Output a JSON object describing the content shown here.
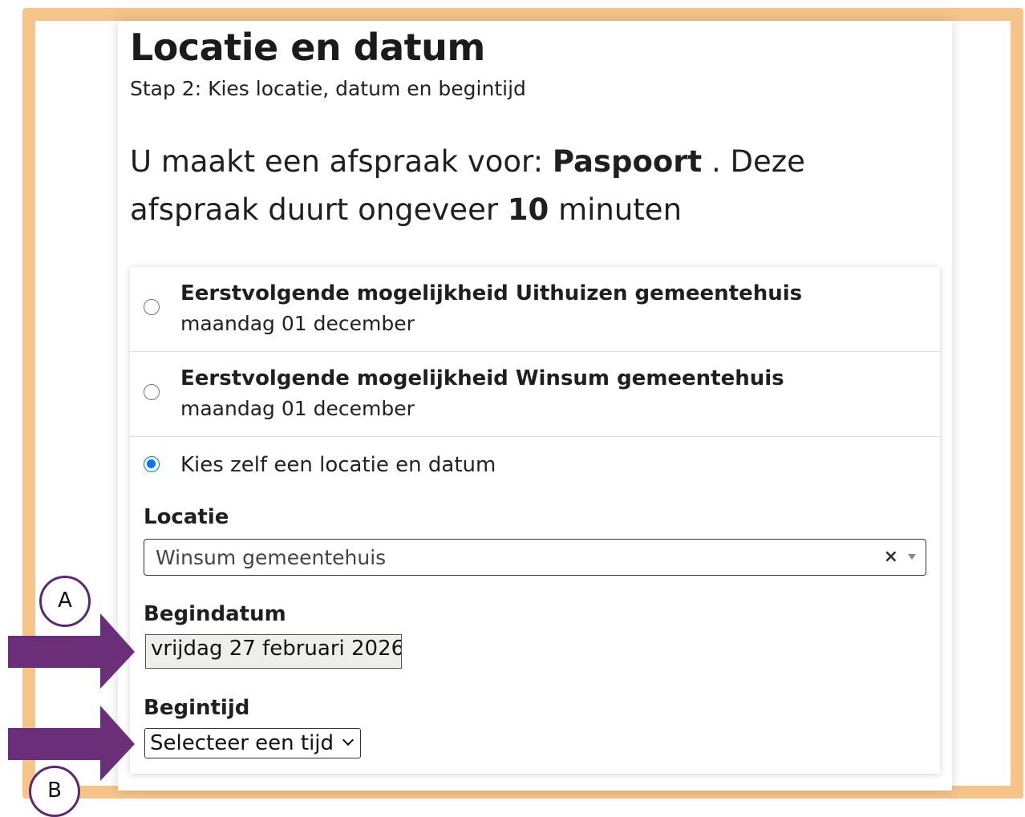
{
  "header": {
    "title": "Locatie en datum",
    "subtitle": "Stap 2: Kies locatie, datum en begintijd"
  },
  "intro": {
    "prefix": "U maakt een afspraak voor: ",
    "service": "Paspoort",
    "middle": " . Deze afspraak duurt ongeveer ",
    "duration": "10",
    "suffix": " minuten"
  },
  "options": [
    {
      "title": "Eerstvolgende mogelijkheid Uithuizen gemeentehuis",
      "date": "maandag 01 december",
      "selected": false
    },
    {
      "title": "Eerstvolgende mogelijkheid Winsum gemeentehuis",
      "date": "maandag 01 december",
      "selected": false
    },
    {
      "title": "Kies zelf een locatie en datum",
      "selected": true
    }
  ],
  "form": {
    "location_label": "Locatie",
    "location_value": "Winsum gemeentehuis",
    "location_clear": "×",
    "start_date_label": "Begindatum",
    "start_date_value": "vrijdag 27 februari 2026",
    "start_time_label": "Begintijd",
    "start_time_value": "Selecteer een tijd"
  },
  "annotations": {
    "marker_a": "A",
    "marker_b": "B"
  },
  "colors": {
    "frame": "#f5c48b",
    "arrow": "#6b2f7a",
    "radio_checked": "#0075ff"
  }
}
